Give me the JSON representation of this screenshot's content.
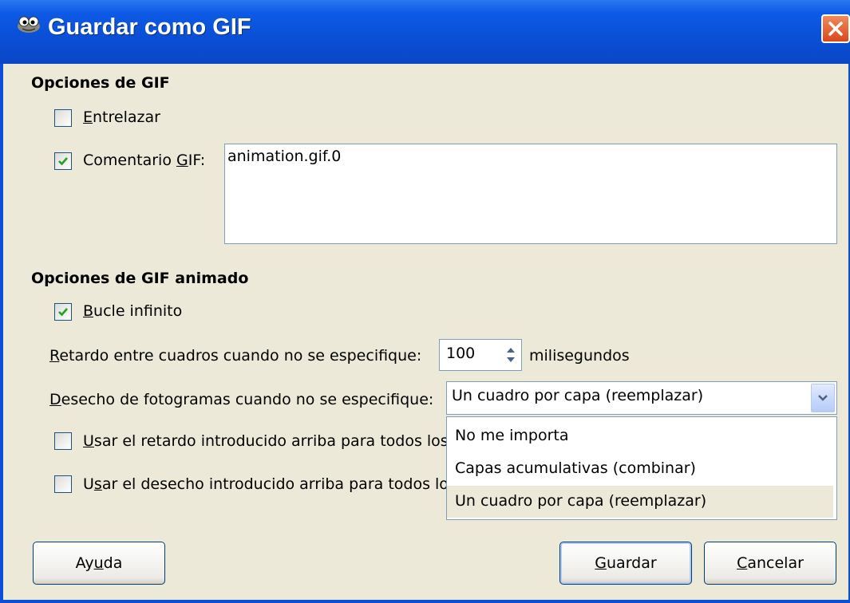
{
  "window": {
    "title": "Guardar como GIF",
    "icon": "gimp-wilber-icon"
  },
  "gif_options": {
    "section_title": "Opciones de GIF",
    "interlace": {
      "label_mnemonic": "E",
      "label_rest": "ntrelazar",
      "checked": false
    },
    "comment": {
      "label_before": "Comentario ",
      "label_mnemonic": "G",
      "label_after": "IF:",
      "checked": true,
      "value": "animation.gif.0"
    }
  },
  "animated_options": {
    "section_title": "Opciones de GIF animado",
    "loop": {
      "label_mnemonic": "B",
      "label_rest": "ucle infinito",
      "checked": true
    },
    "delay": {
      "label_mnemonic": "R",
      "label_rest": "etardo entre cuadros cuando no se especifique:",
      "value": "100",
      "unit": "milisegundos"
    },
    "disposal": {
      "label_mnemonic": "D",
      "label_rest": "esecho de fotogramas cuando no se especifique:",
      "selected": "Un cuadro por capa (reemplazar)",
      "options": [
        "No me importa",
        "Capas acumulativas (combinar)",
        "Un cuadro por capa (reemplazar)"
      ]
    },
    "use_delay_all": {
      "label_mnemonic": "U",
      "label_rest": "sar el retardo introducido arriba para todos los",
      "checked": false
    },
    "use_disposal_all": {
      "label_mnemonic": "s",
      "label_before": "U",
      "label_rest": "ar el desecho introducido arriba para todos lo",
      "checked": false
    }
  },
  "buttons": {
    "help": {
      "before": "Ay",
      "mnemonic": "u",
      "after": "da"
    },
    "save": {
      "mnemonic": "G",
      "after": "uardar"
    },
    "cancel": {
      "mnemonic": "C",
      "after": "ancelar"
    }
  },
  "colors": {
    "titlebar": "#0a4fd6",
    "dialog_bg": "#ece9d8",
    "close": "#d9481c",
    "check": "#21a121"
  }
}
